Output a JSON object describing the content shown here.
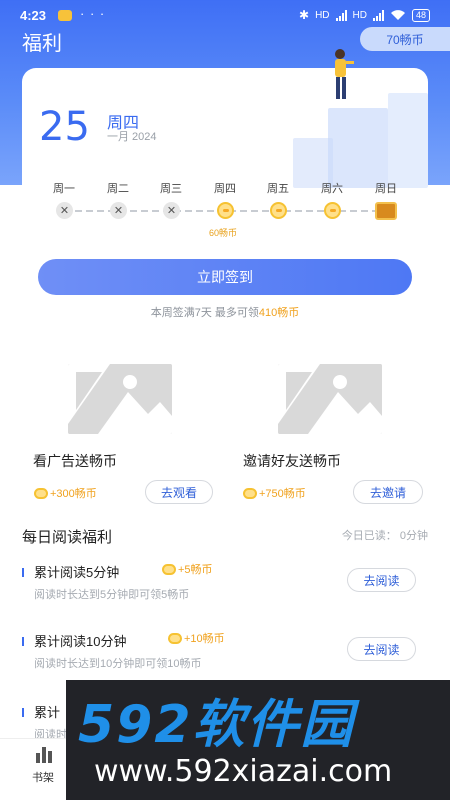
{
  "status_bar": {
    "time": "4:23",
    "dots": "· · ·",
    "signal_labels": [
      "HD",
      "HD"
    ],
    "battery": "48"
  },
  "header": {
    "title": "福利",
    "coin_balance": "70畅币"
  },
  "checkin": {
    "day": "25",
    "weekday": "周四",
    "month_year": "一月 2024",
    "week": [
      {
        "label": "周一",
        "state": "missed",
        "mark": "✕"
      },
      {
        "label": "周二",
        "state": "missed",
        "mark": "✕"
      },
      {
        "label": "周三",
        "state": "missed",
        "mark": "✕"
      },
      {
        "label": "周四",
        "state": "coin",
        "reward": "60畅币"
      },
      {
        "label": "周五",
        "state": "coin"
      },
      {
        "label": "周六",
        "state": "coin"
      },
      {
        "label": "周日",
        "state": "gift"
      }
    ],
    "button_label": "立即签到",
    "note_prefix": "本周签满7天 最多可领",
    "note_highlight": "410畅币"
  },
  "tasks": [
    {
      "title": "看广告送畅币",
      "reward": "+300畅币",
      "action": "去观看"
    },
    {
      "title": "邀请好友送畅币",
      "reward": "+750畅币",
      "action": "去邀请"
    }
  ],
  "daily_reading": {
    "title": "每日阅读福利",
    "today_read": "今日已读： 0分钟",
    "rows": [
      {
        "title": "累计阅读5分钟",
        "reward": "+5畅币",
        "desc": "阅读时长达到5分钟即可领5畅币",
        "action": "去阅读"
      },
      {
        "title": "累计阅读10分钟",
        "reward": "+10畅币",
        "desc": "阅读时长达到10分钟即可领10畅币",
        "action": "去阅读"
      },
      {
        "title": "累计",
        "desc": "阅读时"
      }
    ]
  },
  "tabbar": {
    "bookshelf_label": "书架"
  },
  "watermark": {
    "brand": "592软件园",
    "url": "www.592xiazai.com"
  },
  "colors": {
    "primary": "#3a6bf0",
    "coin": "#f0a21f",
    "hero": "#4f7df6"
  }
}
